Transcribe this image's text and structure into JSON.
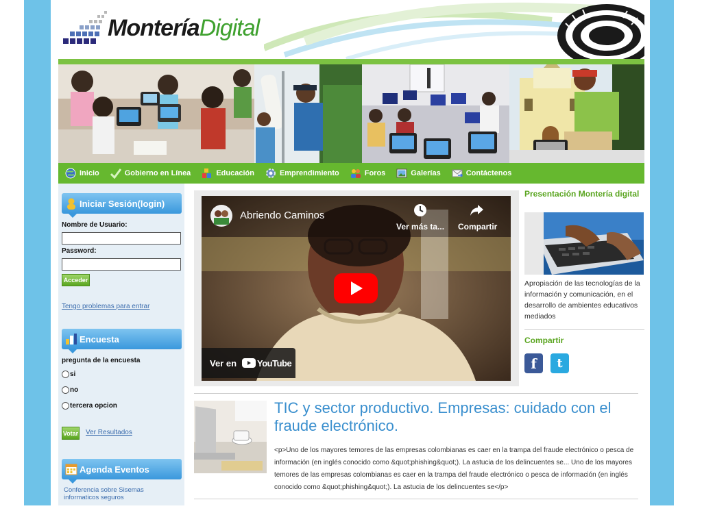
{
  "site": {
    "logo_part1": "Montería",
    "logo_part2": "Digital"
  },
  "nav": {
    "items": [
      {
        "label": "Inicio",
        "icon": "globe-icon"
      },
      {
        "label": "Gobierno en Línea",
        "icon": "checkmark-icon"
      },
      {
        "label": "Educación",
        "icon": "blocks-icon"
      },
      {
        "label": "Emprendimiento",
        "icon": "gear-icon"
      },
      {
        "label": "Foros",
        "icon": "users-icon"
      },
      {
        "label": "Galerías",
        "icon": "picture-icon"
      },
      {
        "label": "Contáctenos",
        "icon": "mail-icon"
      }
    ]
  },
  "login": {
    "title": "Iniciar Sesión(login)",
    "username_label": "Nombre de Usuario:",
    "username_value": "",
    "password_label": "Password:",
    "password_value": "",
    "submit_label": "Acceder",
    "help_link": "Tengo problemas para entrar"
  },
  "poll": {
    "title": "Encuesta",
    "question": "pregunta de la encuesta",
    "options": [
      "si",
      "no",
      "tercera opcion"
    ],
    "vote_label": "Votar",
    "results_link": "Ver Resultados"
  },
  "events": {
    "title": "Agenda Eventos",
    "first_item": "Conferencia sobre Sisemas informaticos seguros"
  },
  "video": {
    "title": "Abriendo Caminos",
    "watch_later": "Ver más ta...",
    "share": "Compartir",
    "watch_on": "Ver en",
    "youtube_label": "YouTube"
  },
  "article": {
    "title": "TIC y sector productivo. Empresas: cuidado con el fraude electrónico.",
    "body": "<p>Uno de los mayores temores de las empresas colombianas es caer en la trampa del fraude electrónico o pesca de información (en inglés conocido como &quot;phishing&quot;). La astucia de los delincuentes se... Uno de los mayores temores de las empresas colombianas es caer en la trampa del fraude electrónico o pesca de información (en inglés conocido como &quot;phishing&quot;). La astucia de los delincuentes se</p>"
  },
  "sidebar_right": {
    "presentation_title": "Presentación Montería digital",
    "presentation_text": "Apropiación de las tecnologías de la información y comunicación, en el desarrollo de ambientes educativos mediados",
    "share_title": "Compartir",
    "social": [
      {
        "glyph": "f",
        "icon": "facebook-icon",
        "color": "#3b5998"
      },
      {
        "glyph": "t",
        "icon": "twitter-icon",
        "color": "#2aa9e0"
      }
    ]
  },
  "colors": {
    "side_band": "#6ec2e8",
    "nav_green": "#66b82f",
    "accent_blue": "#3a8fce",
    "accent_green": "#5aa520"
  }
}
